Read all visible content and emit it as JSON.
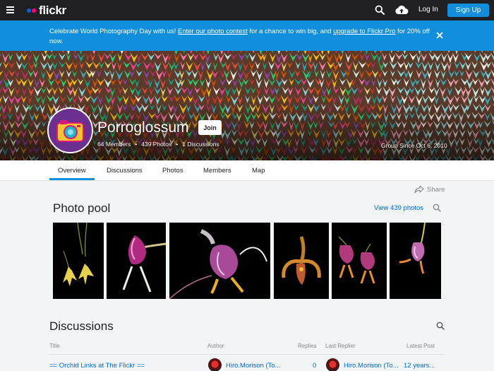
{
  "nav": {
    "logo": "flickr",
    "login": "Log In",
    "signup": "Sign Up"
  },
  "banner": {
    "lead": "Celebrate World Photography Day with us! ",
    "link1": "Enter our photo contest",
    "mid": " for a chance to win big, and ",
    "link2": "upgrade to Flickr Pro",
    "tail": " for 20% off now."
  },
  "group": {
    "name": "Porroglossum",
    "join": "Join",
    "members": "64 Members",
    "photos": "439 Photos",
    "discussions": "1 Discussions",
    "since": "Group Since Oct 6, 2010"
  },
  "tabs": [
    "Overview",
    "Discussions",
    "Photos",
    "Members",
    "Map"
  ],
  "share": "Share",
  "pool": {
    "title": "Photo pool",
    "view_all": "View 439 photos"
  },
  "discussions": {
    "title": "Discussions",
    "columns": [
      "Title",
      "Author",
      "Replies",
      "Last Replier",
      "Latest Post"
    ],
    "rows": [
      {
        "title": "== Orchid Links at The Flickr ==",
        "author": "Hiro.Morison (To...",
        "replies": "0",
        "last_replier": "Hiro.Morison (To...",
        "latest": "12 years..."
      }
    ]
  },
  "colors": {
    "nav_bg": "#212124",
    "banner_bg": "#128fdc",
    "link": "#006add",
    "accent": "#128fdc"
  }
}
